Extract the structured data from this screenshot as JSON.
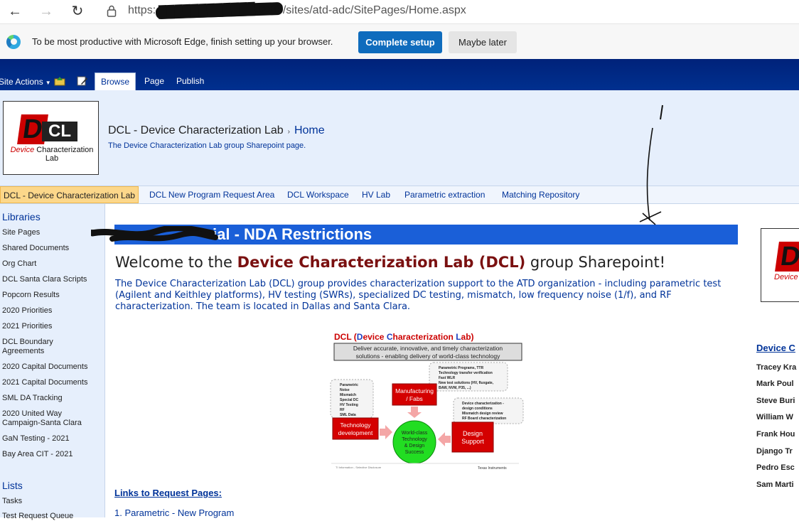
{
  "browser": {
    "url_prefix": "https:",
    "url_host": "████████████.com",
    "url_path": "/sites/atd-adc/SitePages/Home.aspx"
  },
  "edge_prompt": {
    "message": "To be most productive with Microsoft Edge, finish setting up your browser.",
    "primary_button": "Complete setup",
    "secondary_button": "Maybe later"
  },
  "ribbon": {
    "site_actions": "Site Actions",
    "tabs": [
      "Browse",
      "Page",
      "Publish"
    ]
  },
  "header": {
    "logo_d": "D",
    "logo_cl": "CL",
    "logo_word1": "Device",
    "logo_word2": "Characterization",
    "logo_word3": "Lab",
    "site_title": "DCL - Device Characterization Lab",
    "breadcrumb_sep": "›",
    "breadcrumb_home": "Home",
    "description": "The Device Characterization Lab group Sharepoint page."
  },
  "topnav": {
    "items": [
      "DCL - Device Characterization Lab",
      "DCL New Program Request Area",
      "DCL Workspace",
      "HV Lab",
      "Parametric extraction",
      "Matching Repository"
    ]
  },
  "quicklaunch": {
    "libraries_heading": "Libraries",
    "libraries": [
      "Site Pages",
      "Shared Documents",
      "Org Chart",
      "DCL Santa Clara Scripts",
      "Popcorn Results",
      "2020 Priorities",
      "2021 Priorities",
      "DCL Boundary Agreements",
      "2020 Capital Documents",
      "2021 Capital Documents",
      "SML DA Tracking",
      "2020 United Way Campaign-Santa Clara",
      "GaN Testing - 2021",
      "Bay Area CIT - 2021"
    ],
    "lists_heading": "Lists",
    "lists": [
      "Tasks",
      "Test Request Queue"
    ]
  },
  "main": {
    "banner": "ial - NDA Restrictions",
    "welcome_pre": "Welcome to the ",
    "welcome_hl": "Device Characterization Lab (DCL)",
    "welcome_post": " group Sharepoint!",
    "intro": "The Device Characterization Lab (DCL) group provides characterization support to the ATD organization - including parametric test (Agilent and Keithley platforms), HV testing (SWRs), specialized DC testing, mismatch, low frequency noise (1/f), and RF characterization.  The team is located in Dallas and Santa Clara.",
    "links_heading": "Links to Request Pages:",
    "link1": "1. Parametric - New Program"
  },
  "diagram": {
    "title_pre": "DCL (",
    "title_d": "D",
    "title_evice": "evice ",
    "title_c": "C",
    "title_haracterization": "haracterization ",
    "title_l": "L",
    "title_ab": "ab)",
    "mission_line1": "Deliver accurate, innovative, and timely characterization",
    "mission_line2": "solutions - enabling delivery of world-class technology",
    "box_manufacturing_1": "Manufacturing",
    "box_manufacturing_2": "/ Fabs",
    "box_techdev_1": "Technology",
    "box_techdev_2": "development",
    "box_design_1": "Design",
    "box_design_2": "Support",
    "center_1": "World-class",
    "center_2": "Technology",
    "center_3": "& Design",
    "center_4": "Success",
    "list_left": [
      "Parametric",
      "Noise",
      "Mismatch",
      "Special DC",
      "HV Testing",
      "RF",
      "SML Data"
    ],
    "list_top": [
      "Parametric Programs, TTR",
      "Technology transfer verification",
      "Fast WLR",
      "New test solutions (HV, fluxgate,",
      "BAW, NVM, P35, ...)"
    ],
    "list_right": [
      "Device characterization -",
      "design conditions",
      "Mismatch design review",
      "RF Board characterization"
    ],
    "footer_left": "TI Information - Selective Disclosure",
    "footer_right": "Texas Instruments"
  },
  "right_column": {
    "logo_d": "D",
    "logo_text": "Device C",
    "heading": "Device C",
    "names": [
      "Tracey Kra",
      "Mark Poul",
      "Steve Buri",
      "William W",
      "Frank Hou",
      "Django Tr",
      "Pedro Esc",
      "Sam Marti"
    ]
  },
  "colors": {
    "ribbon": "#00308f",
    "banner": "#1a5fd8",
    "link": "#003399",
    "accent_red": "#c00000",
    "edge_button": "#0f6cbd"
  }
}
